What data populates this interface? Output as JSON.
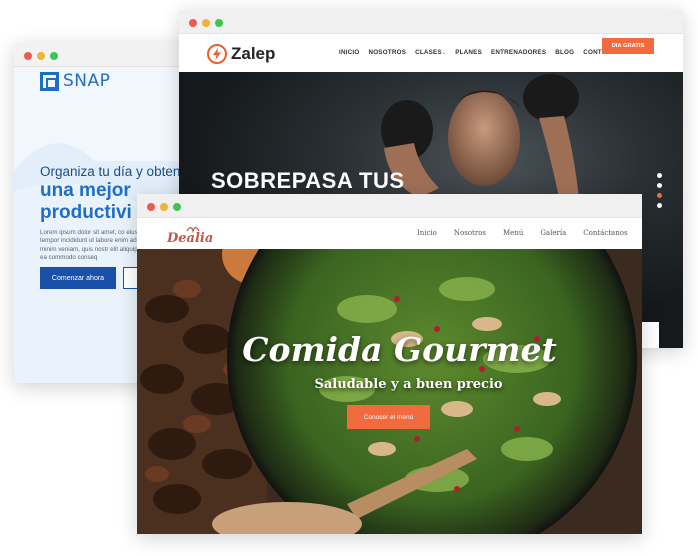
{
  "snap": {
    "logo": "SNAP",
    "headline_line1": "Organiza tu día y obten",
    "headline_line2": "una mejor",
    "headline_line3": "productivi",
    "paragraph": "Lorem ipsum dolor sit amet, co eiusmod tempor incididunt ut labore enim ad minim veniam, quis nostr elit aliquip ex ea commodo conseq",
    "cta_label": "Comenzar ahora"
  },
  "zalep": {
    "logo": "Zalep",
    "menu": [
      "INICIO",
      "NOSOTROS",
      "CLASES",
      "PLANES",
      "ENTRENADORES",
      "BLOG",
      "CONTÁCTANOS"
    ],
    "cta_label": "DIA GRATIS",
    "headline": "SOBREPASA TUS",
    "accent_color": "#f26b3f"
  },
  "dealia": {
    "logo": "Dealia",
    "menu": [
      "Inicio",
      "Nosotros",
      "Menú",
      "Galería",
      "Contáctanos"
    ],
    "title": "Comida Gourmet",
    "subtitle": "Saludable y a buen precio",
    "cta_label": "Conocer el menú",
    "accent_color": "#f26b3f"
  }
}
